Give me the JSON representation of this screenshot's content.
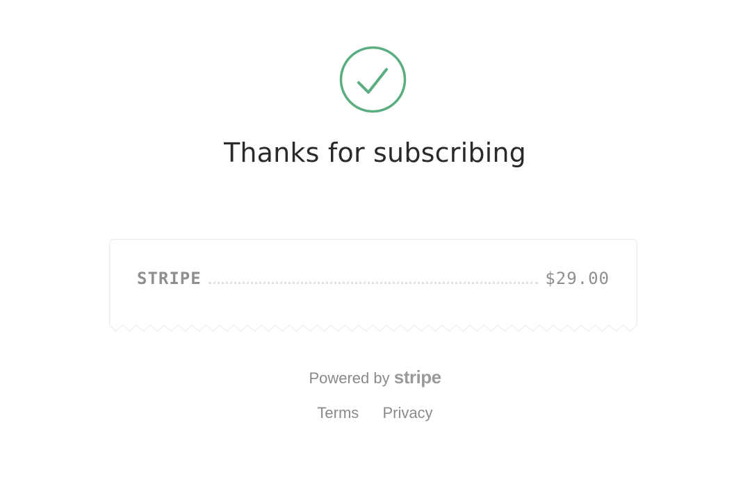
{
  "title": "Thanks for subscribing",
  "receipt": {
    "merchant": "STRIPE",
    "amount": "$29.00"
  },
  "footer": {
    "powered_by_label": "Powered by",
    "brand": "stripe",
    "links": {
      "terms": "Terms",
      "privacy": "Privacy"
    }
  },
  "icons": {
    "success": "check-circle-icon"
  },
  "colors": {
    "success": "#5aad80",
    "title": "#2a2a2a",
    "muted": "#8a8a8a"
  }
}
